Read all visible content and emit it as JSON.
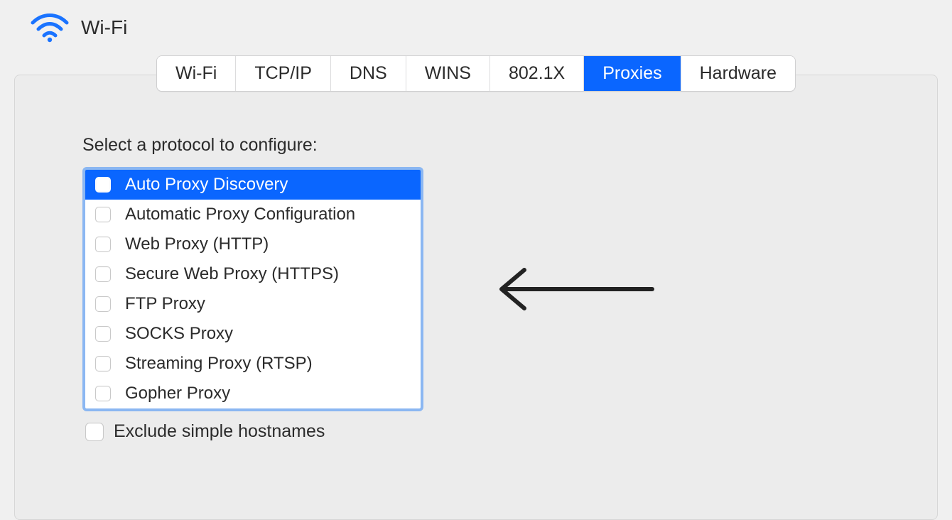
{
  "header": {
    "title": "Wi-Fi",
    "icon": "wifi-icon"
  },
  "tabs": {
    "items": [
      {
        "label": "Wi-Fi",
        "active": false
      },
      {
        "label": "TCP/IP",
        "active": false
      },
      {
        "label": "DNS",
        "active": false
      },
      {
        "label": "WINS",
        "active": false
      },
      {
        "label": "802.1X",
        "active": false
      },
      {
        "label": "Proxies",
        "active": true
      },
      {
        "label": "Hardware",
        "active": false
      }
    ]
  },
  "proxies": {
    "section_label": "Select a protocol to configure:",
    "protocols": [
      {
        "label": "Auto Proxy Discovery",
        "checked": false,
        "selected": true
      },
      {
        "label": "Automatic Proxy Configuration",
        "checked": false,
        "selected": false
      },
      {
        "label": "Web Proxy (HTTP)",
        "checked": false,
        "selected": false
      },
      {
        "label": "Secure Web Proxy (HTTPS)",
        "checked": false,
        "selected": false
      },
      {
        "label": "FTP Proxy",
        "checked": false,
        "selected": false
      },
      {
        "label": "SOCKS Proxy",
        "checked": false,
        "selected": false
      },
      {
        "label": "Streaming Proxy (RTSP)",
        "checked": false,
        "selected": false
      },
      {
        "label": "Gopher Proxy",
        "checked": false,
        "selected": false
      }
    ],
    "exclude_label": "Exclude simple hostnames",
    "exclude_checked": false
  },
  "annotation": {
    "type": "arrow",
    "direction": "left"
  }
}
